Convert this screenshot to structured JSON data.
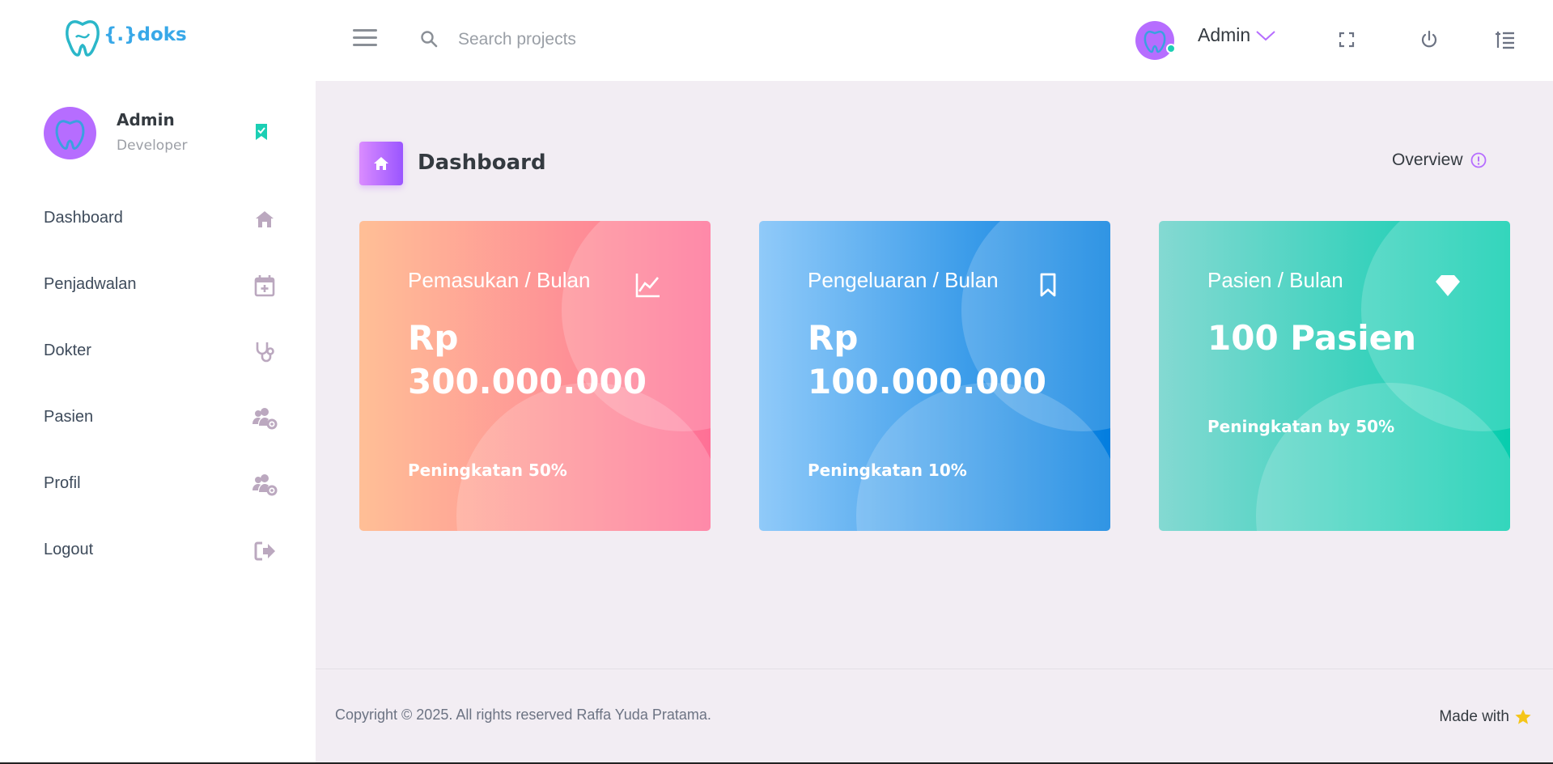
{
  "brand": {
    "text": "{.}doks",
    "icon": "tooth-logo-icon"
  },
  "navbar": {
    "search_placeholder": "Search projects",
    "user_name": "Admin",
    "icons": [
      "menu-icon",
      "search-icon",
      "fullscreen-icon",
      "power-icon",
      "settings-list-icon"
    ]
  },
  "sidebar": {
    "profile": {
      "name": "Admin",
      "role": "Developer"
    },
    "items": [
      {
        "label": "Dashboard",
        "icon": "home-icon"
      },
      {
        "label": "Penjadwalan",
        "icon": "calendar-plus-icon"
      },
      {
        "label": "Dokter",
        "icon": "stethoscope-icon"
      },
      {
        "label": "Pasien",
        "icon": "users-cog-icon"
      },
      {
        "label": "Profil",
        "icon": "users-cog-icon"
      },
      {
        "label": "Logout",
        "icon": "logout-icon"
      }
    ]
  },
  "page": {
    "title": "Dashboard",
    "overview_label": "Overview"
  },
  "cards": [
    {
      "title": "Pemasukan / Bulan",
      "value": "Rp 300.000.000",
      "footer": "Peningkatan 50%",
      "icon": "chart-line-icon"
    },
    {
      "title": "Pengeluaran / Bulan",
      "value": "Rp 100.000.000",
      "footer": "Peningkatan 10%",
      "icon": "bookmark-icon"
    },
    {
      "title": "Pasien / Bulan",
      "value": "100 Pasien",
      "footer": "Peningkatan by 50%",
      "icon": "diamond-icon"
    }
  ],
  "footer": {
    "copyright": "Copyright © 2025. All rights reserved Raffa Yuda Pratama.",
    "made_with": "Made with"
  },
  "colors": {
    "accent": "#b66dff",
    "card1": [
      "#ffbf96",
      "#fe7096"
    ],
    "card2": [
      "#90caf9",
      "#047edf"
    ],
    "card3": [
      "#84d9d2",
      "#07cdae"
    ],
    "online": "#1bcfb4",
    "star": "#f5c518"
  }
}
